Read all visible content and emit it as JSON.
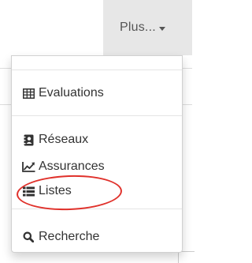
{
  "navbar": {
    "more_label": "Plus..."
  },
  "menu": {
    "items": [
      {
        "label": "Evaluations",
        "icon": "table-icon"
      },
      {
        "label": "Réseaux",
        "icon": "contact-card-icon"
      },
      {
        "label": "Assurances",
        "icon": "line-chart-icon"
      },
      {
        "label": "Listes",
        "icon": "list-icon"
      },
      {
        "label": "Recherche",
        "icon": "search-icon"
      }
    ]
  },
  "annotation": {
    "highlighted_item": "Listes",
    "color": "#e0312b"
  },
  "colors": {
    "toggle_bg": "#e7e7e7",
    "text": "#333333"
  }
}
